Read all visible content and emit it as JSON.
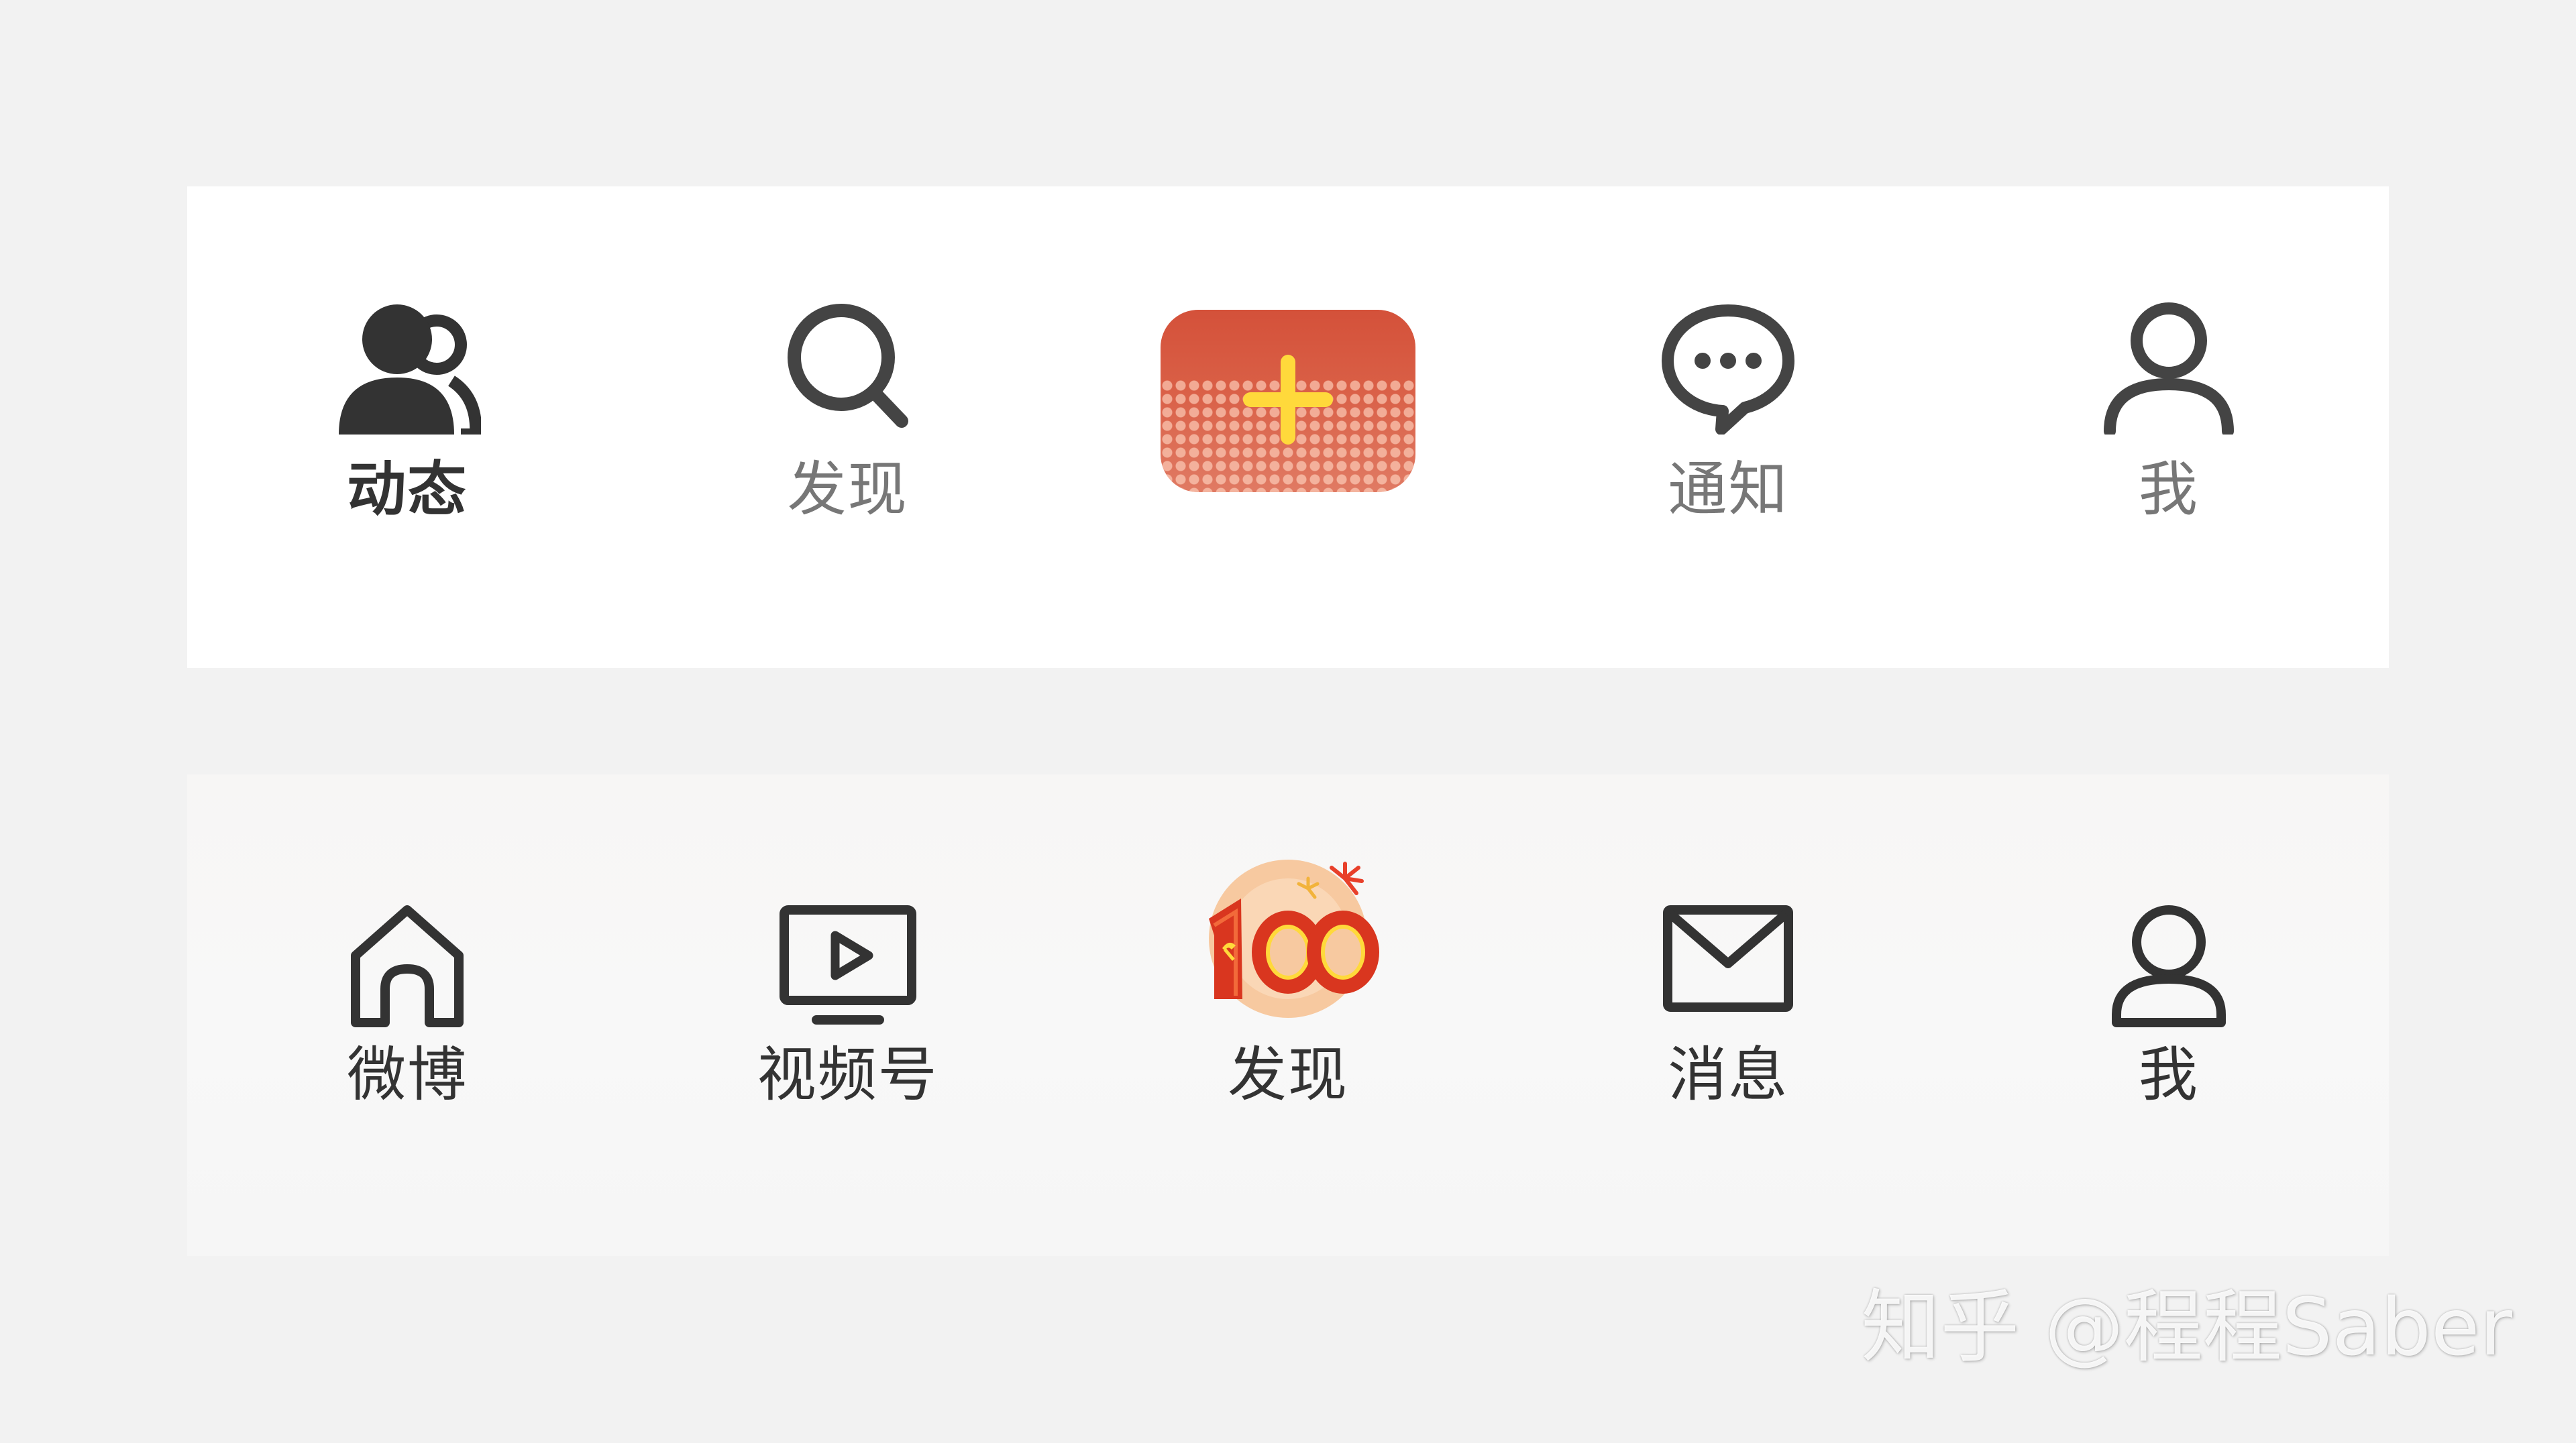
{
  "top_bar": {
    "tabs": [
      {
        "label": "动态",
        "icon": "people-icon",
        "active": true
      },
      {
        "label": "发现",
        "icon": "search-icon",
        "active": false
      },
      {
        "label": "",
        "icon": "plus-icon",
        "active": false
      },
      {
        "label": "通知",
        "icon": "chat-bubble-icon",
        "active": false
      },
      {
        "label": "我",
        "icon": "person-icon",
        "active": false
      }
    ],
    "accent_color": "#D4513A",
    "plus_color": "#FFD93B"
  },
  "bottom_bar": {
    "tabs": [
      {
        "label": "微博",
        "icon": "home-icon"
      },
      {
        "label": "视频号",
        "icon": "tv-play-icon"
      },
      {
        "label": "发现",
        "icon": "anniversary-100-icon",
        "badge_text": "100"
      },
      {
        "label": "消息",
        "icon": "mail-icon"
      },
      {
        "label": "我",
        "icon": "person-icon"
      }
    ]
  },
  "watermark": {
    "text": "知乎 @程程Saber"
  }
}
